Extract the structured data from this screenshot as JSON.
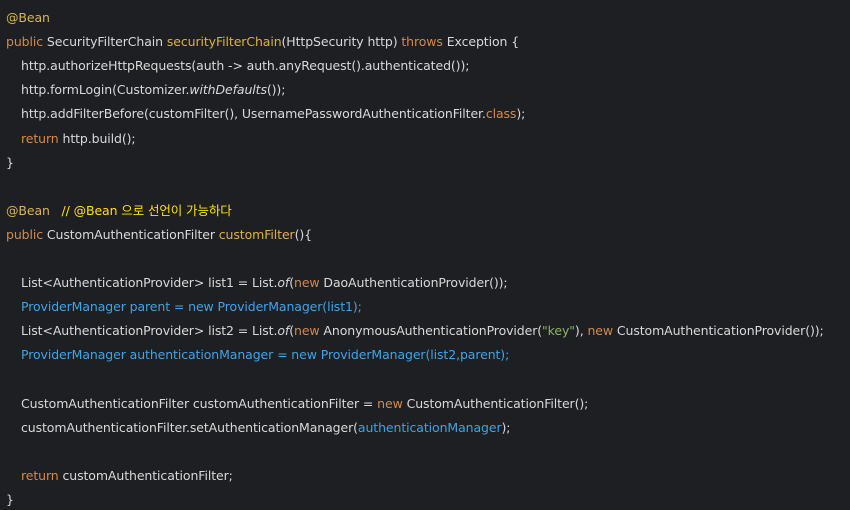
{
  "lines": [
    {
      "tokens": [
        {
          "t": "@Bean",
          "c": "ann"
        }
      ]
    },
    {
      "tokens": [
        {
          "t": "public ",
          "c": "kw"
        },
        {
          "t": "SecurityFilterChain "
        },
        {
          "t": "securityFilterChain",
          "c": "fn"
        },
        {
          "t": "(HttpSecurity http) "
        },
        {
          "t": "throws ",
          "c": "kw"
        },
        {
          "t": "Exception {"
        }
      ]
    },
    {
      "indent": true,
      "tokens": [
        {
          "t": "http.authorizeHttpRequests(auth -> auth.anyRequest().authenticated());"
        }
      ]
    },
    {
      "indent": true,
      "tokens": [
        {
          "t": "http.formLogin(Customizer."
        },
        {
          "t": "withDefaults",
          "c": "it"
        },
        {
          "t": "());"
        }
      ]
    },
    {
      "indent": true,
      "tokens": [
        {
          "t": "http.addFilterBefore(customFilter(), UsernamePasswordAuthenticationFilter."
        },
        {
          "t": "class",
          "c": "kw"
        },
        {
          "t": ");"
        }
      ]
    },
    {
      "indent": true,
      "tokens": [
        {
          "t": "return ",
          "c": "kw"
        },
        {
          "t": "http.build();"
        }
      ]
    },
    {
      "tokens": [
        {
          "t": "}"
        }
      ]
    },
    {
      "tokens": []
    },
    {
      "tokens": [
        {
          "t": "@Bean",
          "c": "ann"
        },
        {
          "t": "   "
        },
        {
          "t": "// @Bean 으로 선언이 가능하다",
          "c": "cmt"
        }
      ]
    },
    {
      "tokens": [
        {
          "t": "public ",
          "c": "kw"
        },
        {
          "t": "CustomAuthenticationFilter "
        },
        {
          "t": "customFilter",
          "c": "fn"
        },
        {
          "t": "(){"
        }
      ]
    },
    {
      "tokens": []
    },
    {
      "indent": true,
      "tokens": [
        {
          "t": "List<AuthenticationProvider> list1 = List."
        },
        {
          "t": "of",
          "c": "it"
        },
        {
          "t": "("
        },
        {
          "t": "new ",
          "c": "kw"
        },
        {
          "t": "DaoAuthenticationProvider());"
        }
      ]
    },
    {
      "indent": true,
      "tokens": [
        {
          "t": "ProviderManager parent = new ProviderManager(list1);",
          "c": "blue"
        }
      ]
    },
    {
      "indent": true,
      "tokens": [
        {
          "t": "List<AuthenticationProvider> list2 = List."
        },
        {
          "t": "of",
          "c": "it"
        },
        {
          "t": "("
        },
        {
          "t": "new ",
          "c": "kw"
        },
        {
          "t": "AnonymousAuthenticationProvider("
        },
        {
          "t": "\"key\"",
          "c": "str"
        },
        {
          "t": "), "
        },
        {
          "t": "new ",
          "c": "kw"
        },
        {
          "t": "CustomAuthenticationProvider());"
        }
      ]
    },
    {
      "indent": true,
      "tokens": [
        {
          "t": "ProviderManager authenticationManager = new ProviderManager(list2,parent);",
          "c": "blue"
        }
      ]
    },
    {
      "tokens": []
    },
    {
      "indent": true,
      "tokens": [
        {
          "t": "CustomAuthenticationFilter customAuthenticationFilter = "
        },
        {
          "t": "new ",
          "c": "kw"
        },
        {
          "t": "CustomAuthenticationFilter();"
        }
      ]
    },
    {
      "indent": true,
      "tokens": [
        {
          "t": "customAuthenticationFilter.setAuthenticationManager("
        },
        {
          "t": "authenticationManager",
          "c": "blue"
        },
        {
          "t": ");"
        }
      ]
    },
    {
      "tokens": []
    },
    {
      "indent": true,
      "tokens": [
        {
          "t": "return ",
          "c": "kw"
        },
        {
          "t": "customAuthenticationFilter;"
        }
      ]
    },
    {
      "tokens": [
        {
          "t": "}"
        }
      ]
    }
  ],
  "colors": {
    "background": "#1e1f22",
    "text": "#d9d9d9",
    "annotation": "#d6b55a",
    "keyword": "#d18a4e",
    "method": "#d9b243",
    "highlight": "#3ea4e8",
    "string": "#8eb06a",
    "comment": "#ffe100"
  }
}
